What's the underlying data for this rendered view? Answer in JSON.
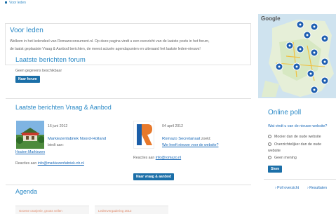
{
  "breadcrumb": {
    "label": "Voor leden"
  },
  "intro": {
    "title": "Voor leden",
    "line1": "Welkom in het ledendeel van Romazoconsument.nl. Op deze pagina vindt u een overzicht van de laatste posts in het forum,",
    "line2": "de laatst geplaatste Vraag & Aanbod berichten, de meest actuele agendapunten en uiteraard het laatste leden-nieuws!"
  },
  "forum": {
    "title": "Laatste berichten forum",
    "empty": "Geen gegevens beschikbaar",
    "button": "Naar forum"
  },
  "vraag_aanbod": {
    "title": "Laatste berichten Vraag & Aanbod",
    "button": "Naar vraag & aanbod",
    "items": [
      {
        "date": "16 juni 2012",
        "author": "Markiezenfabriek Noord-Holland",
        "action": "biedt aan:",
        "subject": "Houten Markiezen",
        "reply_prefix": "Reacties aan",
        "reply_email": "info@markiezenfabriek-nh.nl"
      },
      {
        "date": "04 april 2012",
        "author": "Romazo Secretariaat",
        "action": "zoekt:",
        "subject": "Wie heeft nieuwe voor de website?",
        "reply_prefix": "Reacties aan",
        "reply_email": "info@romazo.nl"
      }
    ]
  },
  "agenda": {
    "title": "Agenda",
    "cards": [
      "Groene oranjerie, groots veilen",
      "Ledenvergadering 2012"
    ]
  },
  "map": {
    "logo": "Google"
  },
  "poll": {
    "title": "Online poll",
    "question": "Wat vindt u van de nieuwe website?",
    "options": [
      "Mooier dan de oude website",
      "Overzichtelijker dan de oude",
      "Geen mening"
    ],
    "option2_cont": "website",
    "submit": "Stem",
    "links": [
      "Poll overzicht",
      "Resultaten"
    ]
  },
  "colors": {
    "accent": "#2a89c6",
    "button": "#1b6fa8"
  }
}
